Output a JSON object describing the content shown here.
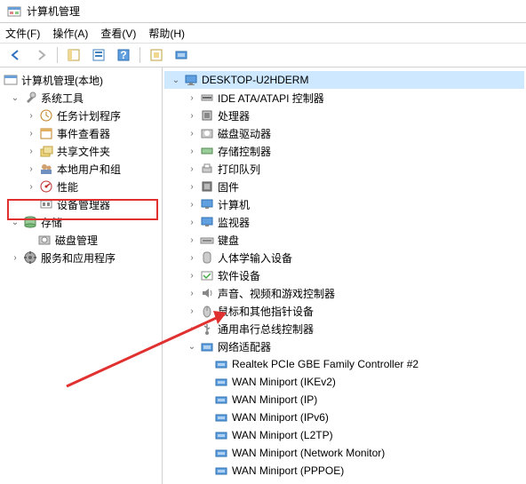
{
  "window": {
    "title": "计算机管理"
  },
  "menu": {
    "file": "文件(F)",
    "action": "操作(A)",
    "view": "查看(V)",
    "help": "帮助(H)"
  },
  "left_tree": {
    "root": {
      "label": "计算机管理(本地)",
      "icon": "mmc"
    },
    "system_tools": {
      "label": "系统工具",
      "icon": "wrench"
    },
    "st_children": [
      {
        "label": "任务计划程序",
        "icon": "clock",
        "has_children": true
      },
      {
        "label": "事件查看器",
        "icon": "event",
        "has_children": true
      },
      {
        "label": "共享文件夹",
        "icon": "share",
        "has_children": true
      },
      {
        "label": "本地用户和组",
        "icon": "users",
        "has_children": true
      },
      {
        "label": "性能",
        "icon": "perf",
        "has_children": true
      },
      {
        "label": "设备管理器",
        "icon": "device",
        "has_children": false,
        "highlighted": true
      }
    ],
    "storage": {
      "label": "存储",
      "icon": "storage"
    },
    "storage_children": [
      {
        "label": "磁盘管理",
        "icon": "disk",
        "has_children": false
      }
    ],
    "services": {
      "label": "服务和应用程序",
      "icon": "services",
      "has_children": true
    }
  },
  "right_tree": {
    "root": {
      "label": "DESKTOP-U2HDERM",
      "icon": "pc"
    },
    "categories": [
      {
        "label": "IDE ATA/ATAPI 控制器",
        "icon": "ide",
        "has_children": true
      },
      {
        "label": "处理器",
        "icon": "cpu",
        "has_children": true
      },
      {
        "label": "磁盘驱动器",
        "icon": "hdd",
        "has_children": true
      },
      {
        "label": "存储控制器",
        "icon": "storage-ctrl",
        "has_children": true
      },
      {
        "label": "打印队列",
        "icon": "printer",
        "has_children": true
      },
      {
        "label": "固件",
        "icon": "firmware",
        "has_children": true
      },
      {
        "label": "计算机",
        "icon": "monitor",
        "has_children": true
      },
      {
        "label": "监视器",
        "icon": "monitor",
        "has_children": true
      },
      {
        "label": "键盘",
        "icon": "keyboard",
        "has_children": true
      },
      {
        "label": "人体学输入设备",
        "icon": "hid",
        "has_children": true
      },
      {
        "label": "软件设备",
        "icon": "software",
        "has_children": true
      },
      {
        "label": "声音、视频和游戏控制器",
        "icon": "sound",
        "has_children": true
      },
      {
        "label": "鼠标和其他指针设备",
        "icon": "mouse",
        "has_children": true
      },
      {
        "label": "通用串行总线控制器",
        "icon": "usb",
        "has_children": true
      }
    ],
    "network": {
      "label": "网络适配器",
      "icon": "net"
    },
    "network_children": [
      {
        "label": "Realtek PCIe GBE Family Controller #2",
        "icon": "net-adapter"
      },
      {
        "label": "WAN Miniport (IKEv2)",
        "icon": "net-adapter"
      },
      {
        "label": "WAN Miniport (IP)",
        "icon": "net-adapter"
      },
      {
        "label": "WAN Miniport (IPv6)",
        "icon": "net-adapter"
      },
      {
        "label": "WAN Miniport (L2TP)",
        "icon": "net-adapter"
      },
      {
        "label": "WAN Miniport (Network Monitor)",
        "icon": "net-adapter"
      },
      {
        "label": "WAN Miniport (PPPOE)",
        "icon": "net-adapter"
      }
    ]
  }
}
